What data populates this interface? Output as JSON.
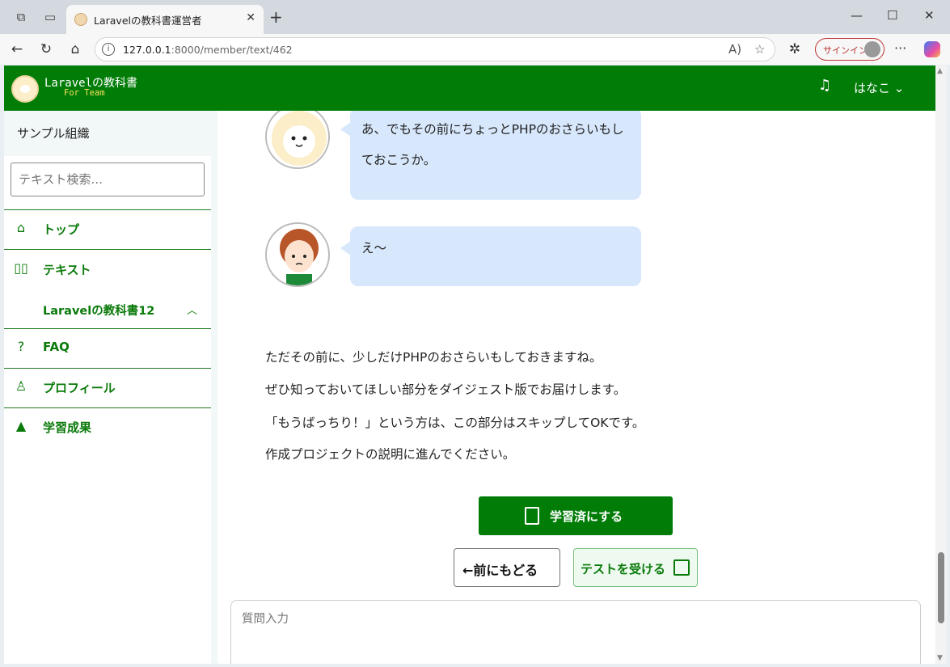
{
  "browser": {
    "tab_title": "Laravelの教科書運営者",
    "tab_close": "✕",
    "new_tab": "+",
    "url_host": "127.0.0.1",
    "url_rest": ":8000/member/text/462",
    "signin_label": "サインイン",
    "more": "···",
    "win_min": "—",
    "win_max": "☐",
    "win_close": "✕"
  },
  "header": {
    "logo_title": "Laravelの教科書",
    "logo_subtitle": "For Team",
    "user_name": "はなこ ⌄"
  },
  "sidebar": {
    "org": "サンプル組織",
    "search_placeholder": "テキスト検索...",
    "items": [
      {
        "label": "トップ",
        "icon": "home-icon"
      },
      {
        "label": "テキスト",
        "icon": "book-icon"
      },
      {
        "label": "FAQ",
        "icon": "help-icon"
      },
      {
        "label": "プロフィール",
        "icon": "user-icon"
      },
      {
        "label": "学習成果",
        "icon": "graduation-icon"
      }
    ],
    "sub_item": "Laravelの教科書12"
  },
  "main": {
    "bubble1": "あ、でもその前にちょっとPHPのおさらいもしておこうか。",
    "bubble2": "え〜",
    "paragraphs": [
      "ただその前に、少しだけPHPのおさらいもしておきますね。",
      "ぜひ知っておいてほしい部分をダイジェスト版でお届けします。",
      "「もうばっちり！」という方は、この部分はスキップしてOKです。",
      "作成プロジェクトの説明に進んでください。"
    ],
    "mark_done": "学習済にする",
    "back": "←前にもどる",
    "take_test": "テストを受ける",
    "question_placeholder": "質問入力"
  },
  "colors": {
    "brand_green": "#007c07",
    "bubble_blue": "#d7e7fc"
  }
}
